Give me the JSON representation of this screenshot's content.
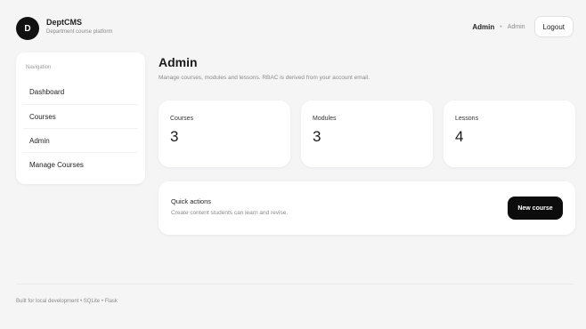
{
  "header": {
    "logo_letter": "D",
    "app_name": "DeptCMS",
    "app_subtitle": "Department course platform",
    "user_name": "Admin",
    "separator": "•",
    "user_role": "Admin",
    "logout_label": "Logout"
  },
  "sidebar": {
    "heading": "Navigation",
    "items": [
      {
        "label": "Dashboard"
      },
      {
        "label": "Courses"
      },
      {
        "label": "Admin"
      },
      {
        "label": "Manage Courses"
      }
    ]
  },
  "main": {
    "title": "Admin",
    "description": "Manage courses, modules and lessons. RBAC is derived from your account email.",
    "stats": [
      {
        "label": "Courses",
        "value": "3"
      },
      {
        "label": "Modules",
        "value": "3"
      },
      {
        "label": "Lessons",
        "value": "4"
      }
    ],
    "quick_actions": {
      "title": "Quick actions",
      "description": "Create content students can learn and revise.",
      "button_label": "New course"
    }
  },
  "footer": {
    "text": "Built for local development • SQLite • Flask"
  },
  "colors": {
    "background": "#f5f5f6",
    "card": "#ffffff",
    "primary_button": "#0c0c0c",
    "text_muted": "#8a8a8a"
  }
}
